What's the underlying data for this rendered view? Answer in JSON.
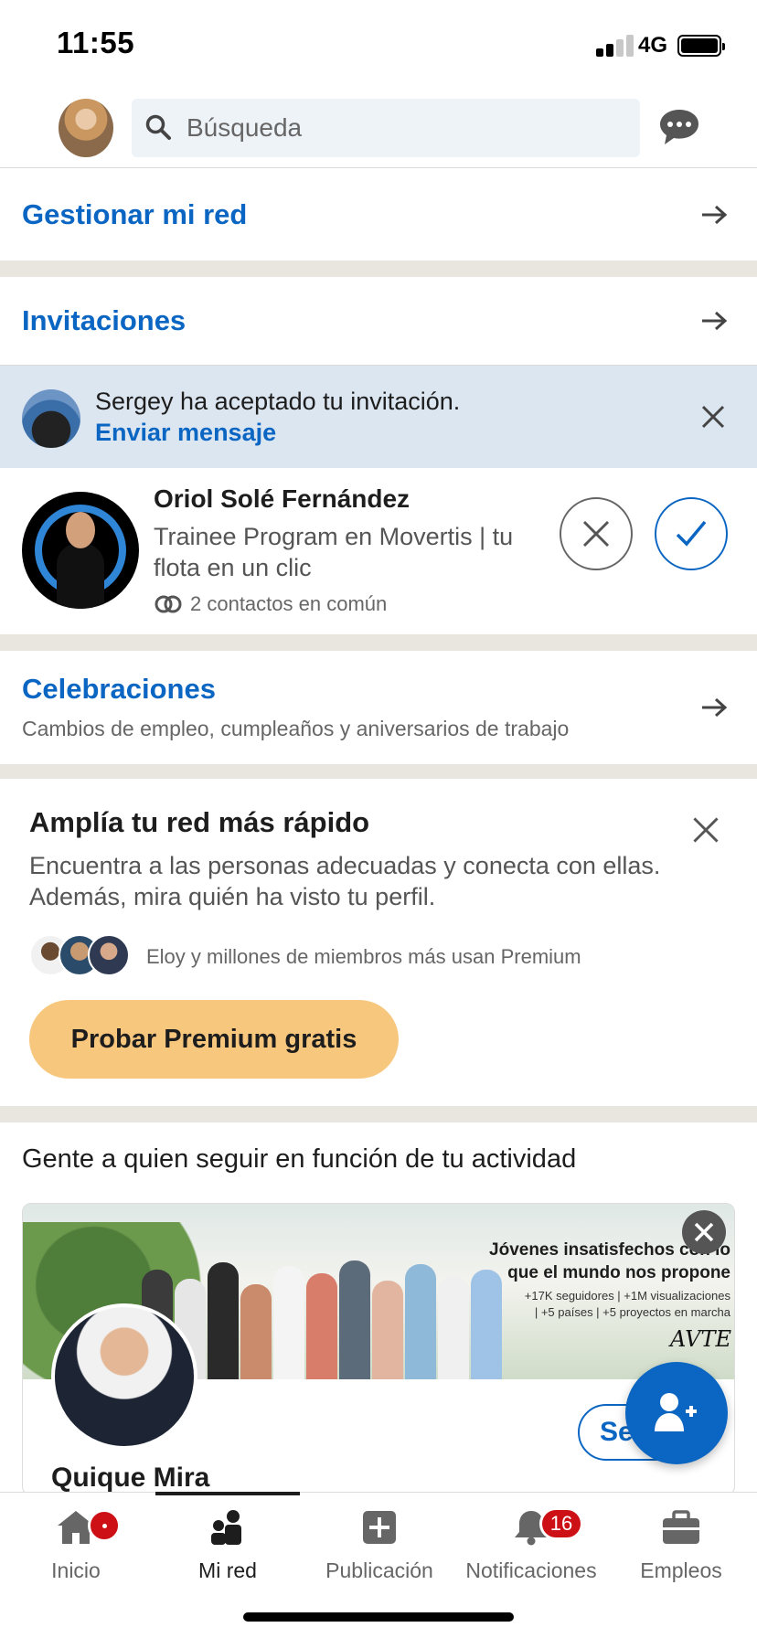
{
  "status_bar": {
    "time": "11:55",
    "network": "4G"
  },
  "header": {
    "search_placeholder": "Búsqueda"
  },
  "sections": {
    "manage_network": "Gestionar mi red",
    "invitations": "Invitaciones",
    "celebrations": {
      "title": "Celebraciones",
      "subtitle": "Cambios de empleo, cumpleaños y aniversarios de trabajo"
    }
  },
  "accepted_notice": {
    "text": "Sergey ha aceptado tu invitación.",
    "link": "Enviar mensaje"
  },
  "invitation": {
    "name": "Oriol Solé Fernández",
    "headline": "Trainee Program en Movertis | tu flota en un clic",
    "mutual": "2 contactos en común"
  },
  "premium": {
    "title": "Amplía tu red más rápido",
    "description": "Encuentra a las personas adecuadas y conecta con ellas. Además, mira quién ha visto tu perfil.",
    "social_proof": "Eloy y millones de miembros más usan Premium",
    "cta": "Probar Premium gratis"
  },
  "follow": {
    "title": "Gente a quien seguir en función de tu actividad",
    "banner_headline": "Jóvenes insatisfechos con lo que el mundo nos propone",
    "banner_stats_1": "+17K seguidores | +1M visualizaciones",
    "banner_stats_2": "| +5 países | +5 proyectos en marcha",
    "banner_logo": "AVTE",
    "person_name": "Quique Mira",
    "follow_label": "Se"
  },
  "tabs": [
    {
      "label": "Inicio"
    },
    {
      "label": "Mi red"
    },
    {
      "label": "Publicación"
    },
    {
      "label": "Notificaciones",
      "badge": "16"
    },
    {
      "label": "Empleos"
    }
  ],
  "colors": {
    "accent": "#0a66c2",
    "premium_button": "#f8c77e",
    "notice_background": "#dce6f1",
    "badge": "#cc1016"
  }
}
